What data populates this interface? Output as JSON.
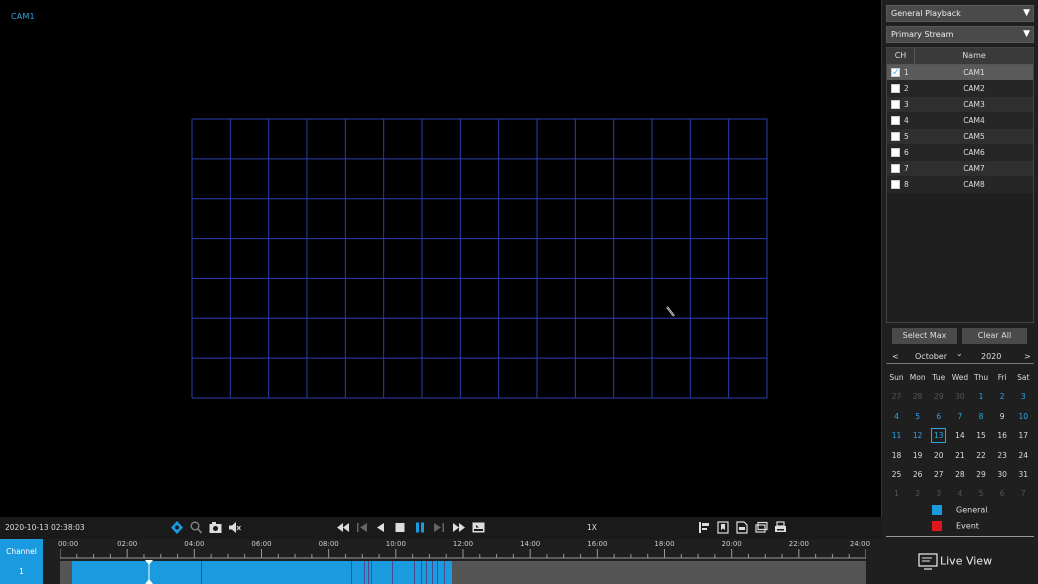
{
  "video": {
    "cam_label": "CAM1"
  },
  "side": {
    "mode_select": "General Playback",
    "stream_select": "Primary Stream",
    "table_header": {
      "ch": "CH",
      "name": "Name"
    },
    "channels": [
      {
        "num": "1",
        "name": "CAM1",
        "checked": true
      },
      {
        "num": "2",
        "name": "CAM2",
        "checked": false
      },
      {
        "num": "3",
        "name": "CAM3",
        "checked": false
      },
      {
        "num": "4",
        "name": "CAM4",
        "checked": false
      },
      {
        "num": "5",
        "name": "CAM5",
        "checked": false
      },
      {
        "num": "6",
        "name": "CAM6",
        "checked": false
      },
      {
        "num": "7",
        "name": "CAM7",
        "checked": false
      },
      {
        "num": "8",
        "name": "CAM8",
        "checked": false
      }
    ],
    "select_max": "Select Max",
    "clear_all": "Clear All",
    "calendar": {
      "prev": "<",
      "month": "October",
      "year": "2020",
      "next": ">",
      "weekdays": [
        "Sun",
        "Mon",
        "Tue",
        "Wed",
        "Thu",
        "Fri",
        "Sat"
      ],
      "weeks": [
        [
          {
            "d": "27",
            "s": "dim"
          },
          {
            "d": "28",
            "s": "dim"
          },
          {
            "d": "29",
            "s": "dim"
          },
          {
            "d": "30",
            "s": "dim"
          },
          {
            "d": "1",
            "s": "rec"
          },
          {
            "d": "2",
            "s": "rec"
          },
          {
            "d": "3",
            "s": "rec"
          }
        ],
        [
          {
            "d": "4",
            "s": "rec"
          },
          {
            "d": "5",
            "s": "rec"
          },
          {
            "d": "6",
            "s": "rec"
          },
          {
            "d": "7",
            "s": "rec"
          },
          {
            "d": "8",
            "s": "rec"
          },
          {
            "d": "9",
            "s": ""
          },
          {
            "d": "10",
            "s": "rec"
          }
        ],
        [
          {
            "d": "11",
            "s": "rec"
          },
          {
            "d": "12",
            "s": "rec"
          },
          {
            "d": "13",
            "s": "today"
          },
          {
            "d": "14",
            "s": ""
          },
          {
            "d": "15",
            "s": ""
          },
          {
            "d": "16",
            "s": ""
          },
          {
            "d": "17",
            "s": ""
          }
        ],
        [
          {
            "d": "18",
            "s": ""
          },
          {
            "d": "19",
            "s": ""
          },
          {
            "d": "20",
            "s": ""
          },
          {
            "d": "21",
            "s": ""
          },
          {
            "d": "22",
            "s": ""
          },
          {
            "d": "23",
            "s": ""
          },
          {
            "d": "24",
            "s": ""
          }
        ],
        [
          {
            "d": "25",
            "s": ""
          },
          {
            "d": "26",
            "s": ""
          },
          {
            "d": "27",
            "s": ""
          },
          {
            "d": "28",
            "s": ""
          },
          {
            "d": "29",
            "s": ""
          },
          {
            "d": "30",
            "s": ""
          },
          {
            "d": "31",
            "s": ""
          }
        ],
        [
          {
            "d": "1",
            "s": "dim"
          },
          {
            "d": "2",
            "s": "dim"
          },
          {
            "d": "3",
            "s": "dim"
          },
          {
            "d": "4",
            "s": "dim"
          },
          {
            "d": "5",
            "s": "dim"
          },
          {
            "d": "6",
            "s": "dim"
          },
          {
            "d": "7",
            "s": "dim"
          }
        ]
      ]
    },
    "legend": [
      {
        "label": "General",
        "color": "#1a9be0"
      },
      {
        "label": "Event",
        "color": "#e0161e"
      }
    ],
    "live_view": "Live View"
  },
  "toolbar": {
    "datetime": "2020-10-13 02:38:03",
    "speed": "1X",
    "accent": "#1a9be0"
  },
  "timeline": {
    "channel_title": "Channel",
    "channel_num": "1",
    "hours": [
      "00:00",
      "02:00",
      "04:00",
      "06:00",
      "08:00",
      "10:00",
      "12:00",
      "14:00",
      "16:00",
      "18:00",
      "20:00",
      "22:00",
      "24:00"
    ]
  }
}
